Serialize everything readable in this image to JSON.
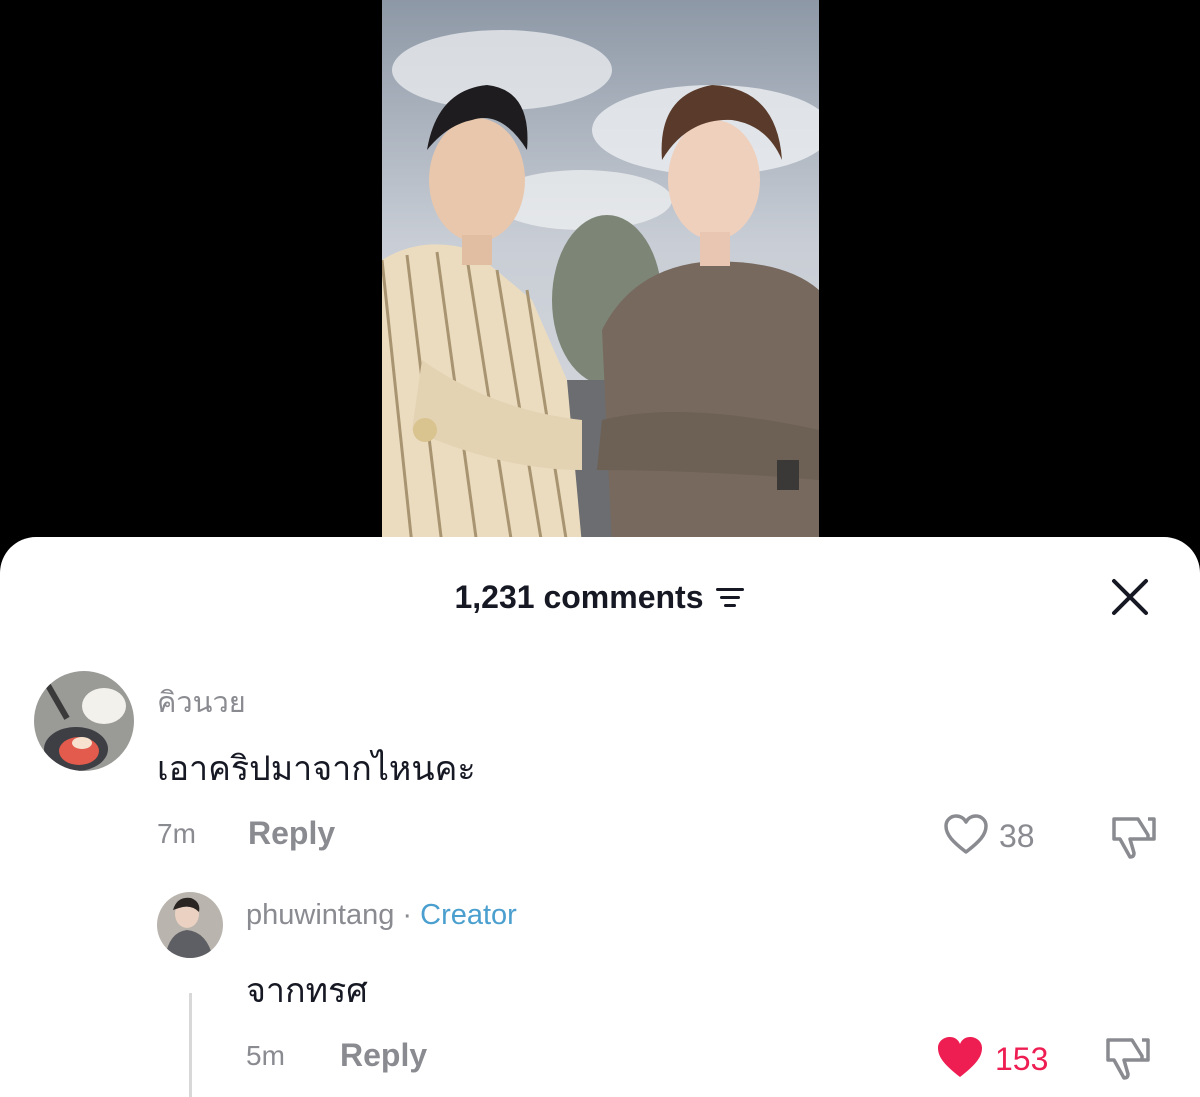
{
  "comments_panel": {
    "count_label": "1,231 comments",
    "filter_icon": "filter-icon",
    "close_icon": "close-icon"
  },
  "comments": [
    {
      "username": "คิวนวย",
      "text": "เอาคริปมาจากไหนคะ",
      "time": "7m",
      "reply_label": "Reply",
      "likes": "38",
      "liked": false
    }
  ],
  "reply": {
    "username": "phuwintang",
    "separator": "·",
    "badge": "Creator",
    "text": "จากทรศ",
    "time": "5m",
    "reply_label": "Reply",
    "likes": "153",
    "liked": true
  },
  "colors": {
    "like_active": "#ee1d52",
    "creator_badge": "#4a9fcf",
    "muted": "#8a8b91",
    "text": "#161823"
  }
}
